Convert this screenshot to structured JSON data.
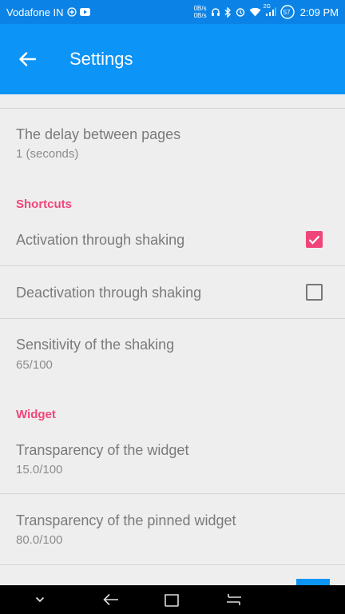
{
  "status_bar": {
    "carrier": "Vodafone IN",
    "net_speed_up": "0B/s",
    "net_speed_down": "0B/s",
    "signal_label": "2G",
    "battery": "57",
    "time": "2:09 PM"
  },
  "app_bar": {
    "title": "Settings"
  },
  "prefs": {
    "delay": {
      "title": "The delay between pages",
      "summary": "1 (seconds)"
    },
    "shortcuts_category": "Shortcuts",
    "activation": {
      "title": "Activation through shaking",
      "checked": true
    },
    "deactivation": {
      "title": "Deactivation through shaking",
      "checked": false
    },
    "sensitivity": {
      "title": "Sensitivity of the shaking",
      "summary": "65/100"
    },
    "widget_category": "Widget",
    "transparency": {
      "title": "Transparency of the widget",
      "summary": "15.0/100"
    },
    "pinned_transparency": {
      "title": "Transparency of the pinned widget",
      "summary": "80.0/100"
    }
  },
  "colors": {
    "app_bar": "#0d94f7",
    "status_bar": "#0b83e6",
    "accent": "#f0457a"
  }
}
